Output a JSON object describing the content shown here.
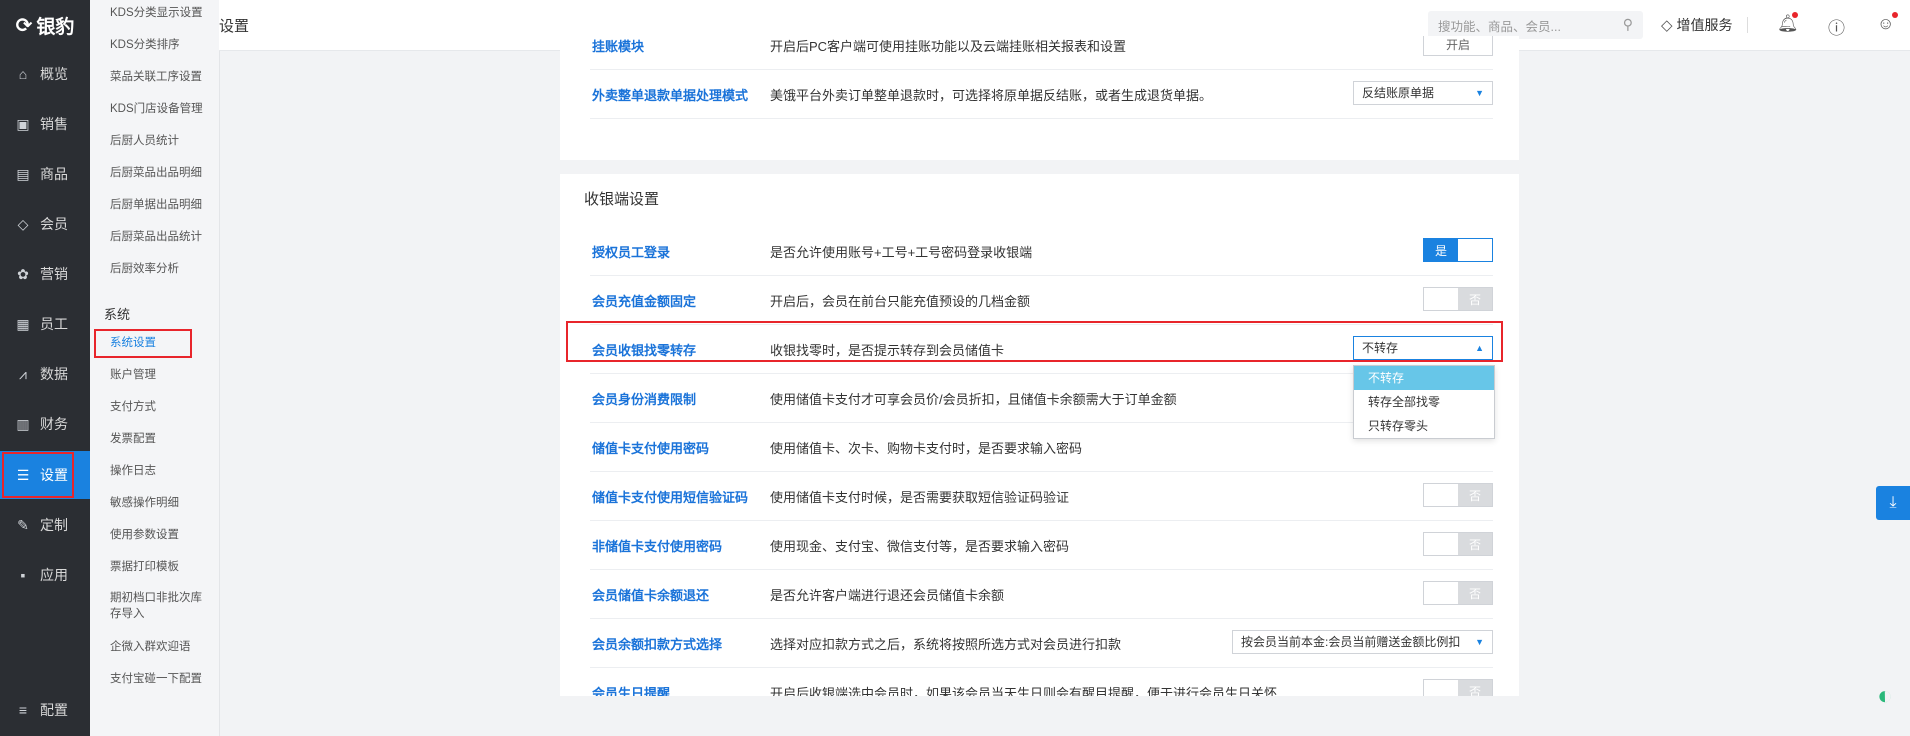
{
  "app": {
    "logo_text": "银豹"
  },
  "nav": [
    {
      "label": "概览",
      "icon": "home-icon",
      "glyph": "⌂"
    },
    {
      "label": "销售",
      "icon": "sales-icon",
      "glyph": "▣"
    },
    {
      "label": "商品",
      "icon": "product-icon",
      "glyph": "▤"
    },
    {
      "label": "会员",
      "icon": "member-icon",
      "glyph": "◇"
    },
    {
      "label": "营销",
      "icon": "marketing-icon",
      "glyph": "✿"
    },
    {
      "label": "员工",
      "icon": "staff-icon",
      "glyph": "▦"
    },
    {
      "label": "数据",
      "icon": "data-icon",
      "glyph": "⩘"
    },
    {
      "label": "财务",
      "icon": "finance-icon",
      "glyph": "▥"
    },
    {
      "label": "设置",
      "icon": "settings-icon",
      "glyph": "☰"
    },
    {
      "label": "定制",
      "icon": "custom-icon",
      "glyph": "✎"
    },
    {
      "label": "应用",
      "icon": "apps-icon",
      "glyph": "▪"
    }
  ],
  "nav_bottom": {
    "label": "配置",
    "glyph": "≡"
  },
  "submenu": {
    "top_items": [
      "KDS分类显示设置",
      "KDS分类排序",
      "菜品关联工序设置",
      "KDS门店设备管理",
      "后厨人员统计",
      "后厨菜品出品明细",
      "后厨单据出品明细",
      "后厨菜品出品统计",
      "后厨效率分析"
    ],
    "section": "系统",
    "items": [
      "系统设置",
      "账户管理",
      "支付方式",
      "发票配置",
      "操作日志",
      "敏感操作明细",
      "使用参数设置",
      "票据打印模板",
      "期初档口非批次库存导入",
      "企微入群欢迎语",
      "支付宝碰一下配置"
    ]
  },
  "header": {
    "title": "设置",
    "search_placeholder": "搜功能、商品、会员...",
    "value_service": "增值服务"
  },
  "top_rows": [
    {
      "label": "挂账模块",
      "desc": "开启后PC客户端可使用挂账功能以及云端挂账相关报表和设置",
      "control": "button",
      "value": "开启"
    },
    {
      "label": "外卖整单退款单据处理模式",
      "desc": "美饿平台外卖订单整单退款时，可选择将原单据反结账，或者生成退货单据。",
      "control": "select",
      "value": "反结账原单据"
    }
  ],
  "cashier": {
    "title": "收银端设置",
    "rows": [
      {
        "label": "授权员工登录",
        "desc": "是否允许使用账号+工号+工号密码登录收银端",
        "control": "toggle",
        "state": "on",
        "on_text": "是",
        "off_text": ""
      },
      {
        "label": "会员充值金额固定",
        "desc": "开启后，会员在前台只能充值预设的几档金额",
        "control": "toggle",
        "state": "off",
        "on_text": "",
        "off_text": "否"
      },
      {
        "label": "会员收银找零转存",
        "desc": "收银找零时，是否提示转存到会员储值卡",
        "control": "select",
        "value": "不转存",
        "open": true
      },
      {
        "label": "会员身份消费限制",
        "desc": "使用储值卡支付才可享会员价/会员折扣，且储值卡余额需大于订单金额",
        "control": "none"
      },
      {
        "label": "储值卡支付使用密码",
        "desc": "使用储值卡、次卡、购物卡支付时，是否要求输入密码",
        "control": "none"
      },
      {
        "label": "储值卡支付使用短信验证码",
        "desc": "使用储值卡支付时候，是否需要获取短信验证码验证",
        "control": "toggle",
        "state": "off",
        "on_text": "",
        "off_text": "否"
      },
      {
        "label": "非储值卡支付使用密码",
        "desc": "使用现金、支付宝、微信支付等，是否要求输入密码",
        "control": "toggle",
        "state": "off",
        "on_text": "",
        "off_text": "否"
      },
      {
        "label": "会员储值卡余额退还",
        "desc": "是否允许客户端进行退还会员储值卡余额",
        "control": "toggle",
        "state": "off",
        "on_text": "",
        "off_text": "否"
      },
      {
        "label": "会员余额扣款方式选择",
        "desc": "选择对应扣款方式之后，系统将按照所选方式对会员进行扣款",
        "control": "select",
        "value": "按会员当前本金:会员当前赠送金额比例扣"
      },
      {
        "label": "会员生日提醒",
        "desc": "开启后收银端选中会员时，如果该会员当天生日则会有醒目提醒，便于进行会员生日关怀",
        "control": "toggle",
        "state": "off",
        "on_text": "",
        "off_text": "否"
      }
    ]
  },
  "dropdown_options": [
    "不转存",
    "转存全部找零",
    "只转存零头"
  ]
}
